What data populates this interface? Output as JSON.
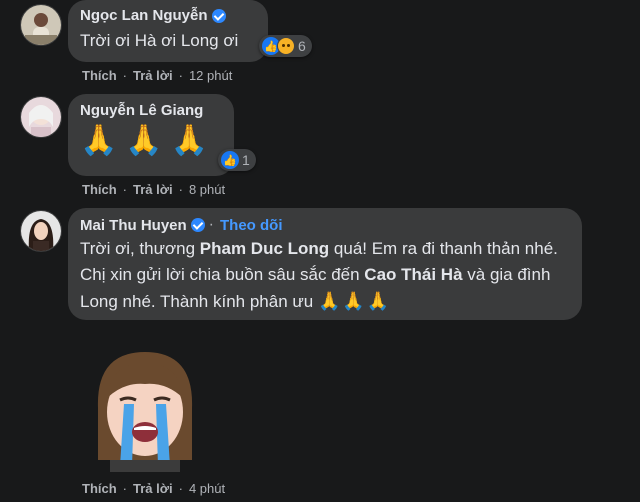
{
  "comments": [
    {
      "author": "Ngọc Lan Nguyễn",
      "text": "Trời ơi Hà ơi Long ơi",
      "reaction_count": "6",
      "like": "Thích",
      "reply": "Trả lời",
      "time": "12 phút"
    },
    {
      "author": "Nguyễn Lê Giang",
      "emoji": "🙏🙏🙏",
      "reaction_count": "1",
      "like": "Thích",
      "reply": "Trả lời",
      "time": "8 phút"
    },
    {
      "author": "Mai Thu Huyen",
      "follow": "Theo dõi",
      "text_part1": "Trời ơi, thương ",
      "mention1": "Pham Duc Long",
      "text_part2": " quá! Em ra đi thanh thản nhé. Chị xin gửi lời chia buồn sâu sắc đến ",
      "mention2": "Cao Thái Hà",
      "text_part3": " và gia đình Long nhé. Thành kính phân ưu ",
      "emoji": "🙏🙏🙏",
      "like": "Thích",
      "reply": "Trả lời",
      "time": "4 phút"
    }
  ],
  "icons": {
    "verified": "verified-badge-icon",
    "like": "like-reaction-icon",
    "sad": "sad-reaction-icon"
  },
  "colors": {
    "background": "#18191a",
    "bubble": "#3a3b3c",
    "link_blue": "#4599ff"
  }
}
